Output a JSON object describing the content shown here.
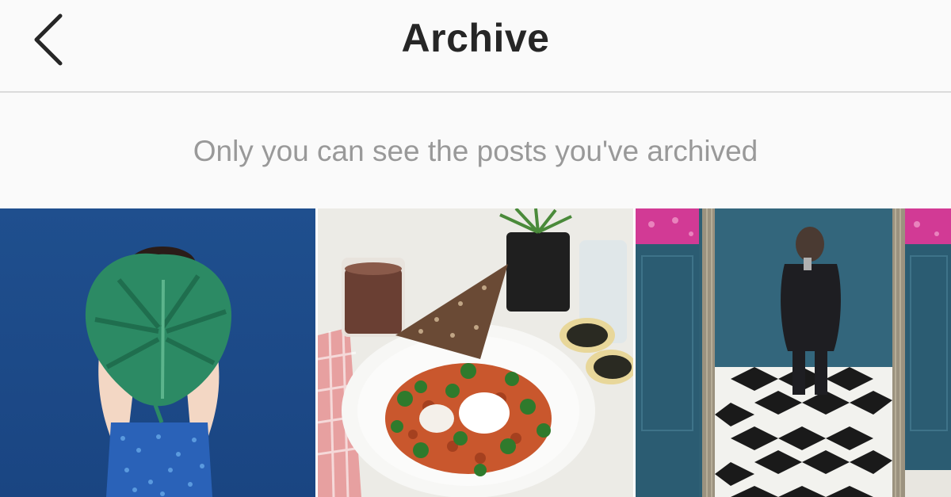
{
  "header": {
    "title": "Archive",
    "back_icon": "chevron-left-icon"
  },
  "notice": {
    "text": "Only you can see the posts you've archived"
  },
  "posts": [
    {
      "subject": "monstera-leaf-photo"
    },
    {
      "subject": "breakfast-plate-photo"
    },
    {
      "subject": "mirror-selfie-photo"
    }
  ],
  "colors": {
    "header_bg": "#fafafa",
    "title": "#262626",
    "notice_text": "#999999",
    "divider": "#dbdbdb"
  }
}
